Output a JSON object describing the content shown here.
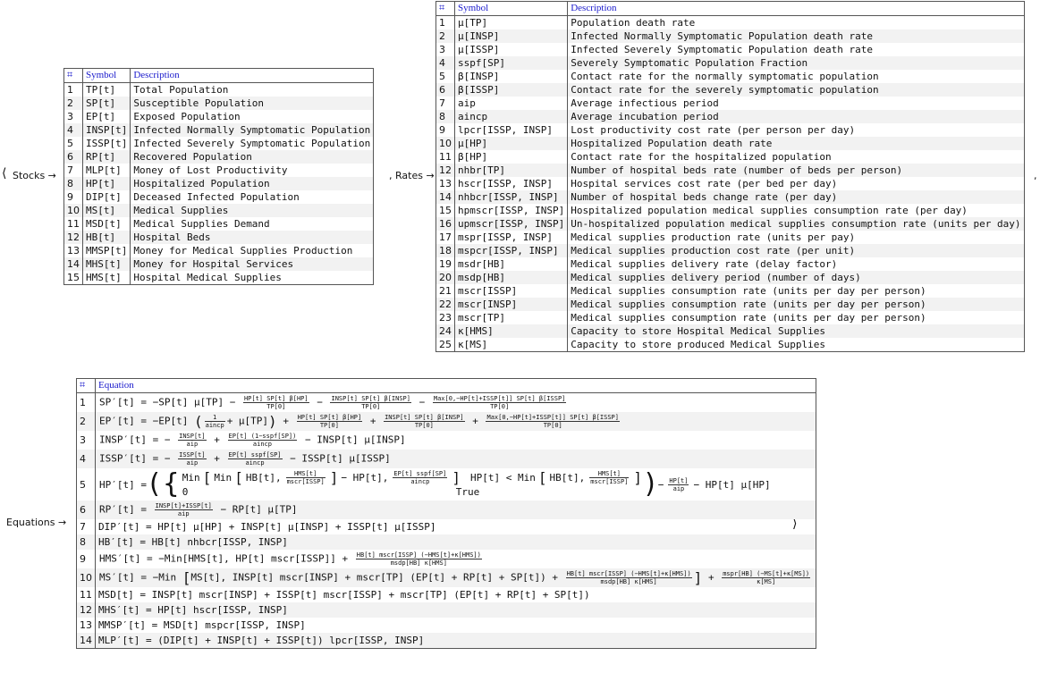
{
  "punctuation": {
    "open": "⟨",
    "close": "⟩",
    "comma1": ",",
    "comma2": ","
  },
  "labels": {
    "stocks": "Stocks →",
    "rates": ", Rates →",
    "equations": "Equations →"
  },
  "stocks_table": {
    "headers": [
      "⌗",
      "Symbol",
      "Description"
    ],
    "rows": [
      [
        "1",
        "TP[t]",
        "Total Population"
      ],
      [
        "2",
        "SP[t]",
        "Susceptible Population"
      ],
      [
        "3",
        "EP[t]",
        "Exposed Population"
      ],
      [
        "4",
        "INSP[t]",
        "Infected Normally Symptomatic Population"
      ],
      [
        "5",
        "ISSP[t]",
        "Infected Severely Symptomatic Population"
      ],
      [
        "6",
        "RP[t]",
        "Recovered Population"
      ],
      [
        "7",
        "MLP[t]",
        "Money of Lost Productivity"
      ],
      [
        "8",
        "HP[t]",
        "Hospitalized Population"
      ],
      [
        "9",
        "DIP[t]",
        "Deceased Infected Population"
      ],
      [
        "10",
        "MS[t]",
        "Medical Supplies"
      ],
      [
        "11",
        "MSD[t]",
        "Medical Supplies Demand"
      ],
      [
        "12",
        "HB[t]",
        "Hospital Beds"
      ],
      [
        "13",
        "MMSP[t]",
        "Money for Medical Supplies Production"
      ],
      [
        "14",
        "MHS[t]",
        "Money for Hospital Services"
      ],
      [
        "15",
        "HMS[t]",
        "Hospital Medical Supplies"
      ]
    ]
  },
  "rates_table": {
    "headers": [
      "⌗",
      "Symbol",
      "Description"
    ],
    "rows": [
      [
        "1",
        "μ[TP]",
        "Population death rate"
      ],
      [
        "2",
        "μ[INSP]",
        "Infected Normally Symptomatic Population death rate"
      ],
      [
        "3",
        "μ[ISSP]",
        "Infected Severely Symptomatic Population death rate"
      ],
      [
        "4",
        "sspf[SP]",
        "Severely Symptomatic Population Fraction"
      ],
      [
        "5",
        "β[INSP]",
        "Contact rate for the normally symptomatic population"
      ],
      [
        "6",
        "β[ISSP]",
        "Contact rate for the severely symptomatic population"
      ],
      [
        "7",
        "aip",
        "Average infectious period"
      ],
      [
        "8",
        "aincp",
        "Average incubation period"
      ],
      [
        "9",
        "lpcr[ISSP, INSP]",
        "Lost productivity cost rate (per person per day)"
      ],
      [
        "10",
        "μ[HP]",
        "Hospitalized Population death rate"
      ],
      [
        "11",
        "β[HP]",
        "Contact rate for the hospitalized population"
      ],
      [
        "12",
        "nhbr[TP]",
        "Number of hospital beds rate (number of beds per person)"
      ],
      [
        "13",
        "hscr[ISSP, INSP]",
        "Hospital services cost rate (per bed per day)"
      ],
      [
        "14",
        "nhbcr[ISSP, INSP]",
        "Number of hospital beds change rate (per day)"
      ],
      [
        "15",
        "hpmscr[ISSP, INSP]",
        "Hospitalized population medical supplies consumption rate (per day)"
      ],
      [
        "16",
        "upmscr[ISSP, INSP]",
        "Un-hospitalized population medical supplies consumption rate (units per day)"
      ],
      [
        "17",
        "mspr[ISSP, INSP]",
        "Medical supplies production rate (units per pay)"
      ],
      [
        "18",
        "mspcr[ISSP, INSP]",
        "Medical supplies production cost rate (per unit)"
      ],
      [
        "19",
        "msdr[HB]",
        "Medical supplies delivery rate (delay factor)"
      ],
      [
        "20",
        "msdp[HB]",
        "Medical supplies delivery period (number of days)"
      ],
      [
        "21",
        "mscr[ISSP]",
        "Medical supplies consumption rate (units per day per person)"
      ],
      [
        "22",
        "mscr[INSP]",
        "Medical supplies consumption rate (units per day per person)"
      ],
      [
        "23",
        "mscr[TP]",
        "Medical supplies consumption rate (units per day per person)"
      ],
      [
        "24",
        "κ[HMS]",
        "Capacity to store Hospital Medical Supplies"
      ],
      [
        "25",
        "κ[MS]",
        "Capacity to store produced Medical Supplies"
      ]
    ]
  },
  "equations_table": {
    "headers": [
      "⌗",
      "Equation"
    ],
    "numbers": [
      "1",
      "2",
      "3",
      "4",
      "5",
      "6",
      "7",
      "8",
      "9",
      "10",
      "11",
      "12",
      "13",
      "14"
    ],
    "eq1": {
      "a": "SP′[t] = −SP[t] μ[TP] −",
      "f1n": "HP[t] SP[t] β[HP]",
      "f1d": "TP[0]",
      "m1": "−",
      "f2n": "INSP[t] SP[t] β[INSP]",
      "f2d": "TP[0]",
      "m2": "−",
      "f3n": "Max[0,−HP[t]+ISSP[t]] SP[t] β[ISSP]",
      "f3d": "TP[0]"
    },
    "eq2": {
      "a": "EP′[t] = −EP[t]",
      "p1": "(",
      "f1n": "1",
      "f1d": "aincp",
      "b": "+ μ[TP]",
      "p2": ")",
      "c": "+",
      "f2n": "HP[t] SP[t] β[HP]",
      "f2d": "TP[0]",
      "d": "+",
      "f3n": "INSP[t] SP[t] β[INSP]",
      "f3d": "TP[0]",
      "e": "+",
      "f4n": "Max[0,−HP[t]+ISSP[t]] SP[t] β[ISSP]",
      "f4d": "TP[0]"
    },
    "eq3": {
      "a": "INSP′[t] = −",
      "f1n": "INSP[t]",
      "f1d": "aip",
      "b": "+",
      "f2n": "EP[t] (1−sspf[SP])",
      "f2d": "aincp",
      "c": "− INSP[t] μ[INSP]"
    },
    "eq4": {
      "a": "ISSP′[t] = −",
      "f1n": "ISSP[t]",
      "f1d": "aip",
      "b": "+",
      "f2n": "EP[t] sspf[SP]",
      "f2d": "aincp",
      "c": "− ISSP[t] μ[ISSP]"
    },
    "eq5": {
      "a": "HP′[t] =",
      "lp": "(",
      "br": "{",
      "r1a": "Min",
      "r1b": "Min",
      "r1c": "HB[t],",
      "r1fn": "HMS[t]",
      "r1fd": "mscr[ISSP]",
      "r1d": "− HP[t],",
      "r1gn": "EP[t] sspf[SP]",
      "r1gd": "aincp",
      "cond1": "HP[t] < Min",
      "cond1b": "HB[t],",
      "cfn": "HMS[t]",
      "cfd": "mscr[ISSP]",
      "r2a": "0",
      "cond2": "True",
      "rp": ")",
      "m": "−",
      "f3n": "HP[t]",
      "f3d": "aip",
      "z": "− HP[t] μ[HP]"
    },
    "eq6": {
      "a": "RP′[t] =",
      "f1n": "INSP[t]+ISSP[t]",
      "f1d": "aip",
      "b": "− RP[t] μ[TP]"
    },
    "eq7": "DIP′[t] = HP[t] μ[HP] + INSP[t] μ[INSP] + ISSP[t] μ[ISSP]",
    "eq8": "HB′[t] = HB[t] nhbcr[ISSP, INSP]",
    "eq9": {
      "a": "HMS′[t] = −Min[HMS[t], HP[t] mscr[ISSP]] +",
      "f1n": "HB[t] mscr[ISSP] (−HMS[t]+κ[HMS])",
      "f1d": "msdp[HB] κ[HMS]"
    },
    "eq10": {
      "a": "MS′[t] = −Min",
      "b": "MS[t], INSP[t] mscr[INSP] + mscr[TP] (EP[t] + RP[t] + SP[t]) +",
      "f1n": "HB[t] mscr[ISSP] (−HMS[t]+κ[HMS])",
      "f1d": "msdp[HB] κ[HMS]",
      "c": "+",
      "f2n": "mspr[HB] (−MS[t]+κ[MS])",
      "f2d": "κ[MS]"
    },
    "eq11": "MSD[t] = INSP[t] mscr[INSP] + ISSP[t] mscr[ISSP] + mscr[TP] (EP[t] + RP[t] + SP[t])",
    "eq12": "MHS′[t] = HP[t] hscr[ISSP, INSP]",
    "eq13": "MMSP′[t] = MSD[t] mspcr[ISSP, INSP]",
    "eq14": "MLP′[t] = (DIP[t] + INSP[t] + ISSP[t]) lpcr[ISSP, INSP]"
  }
}
